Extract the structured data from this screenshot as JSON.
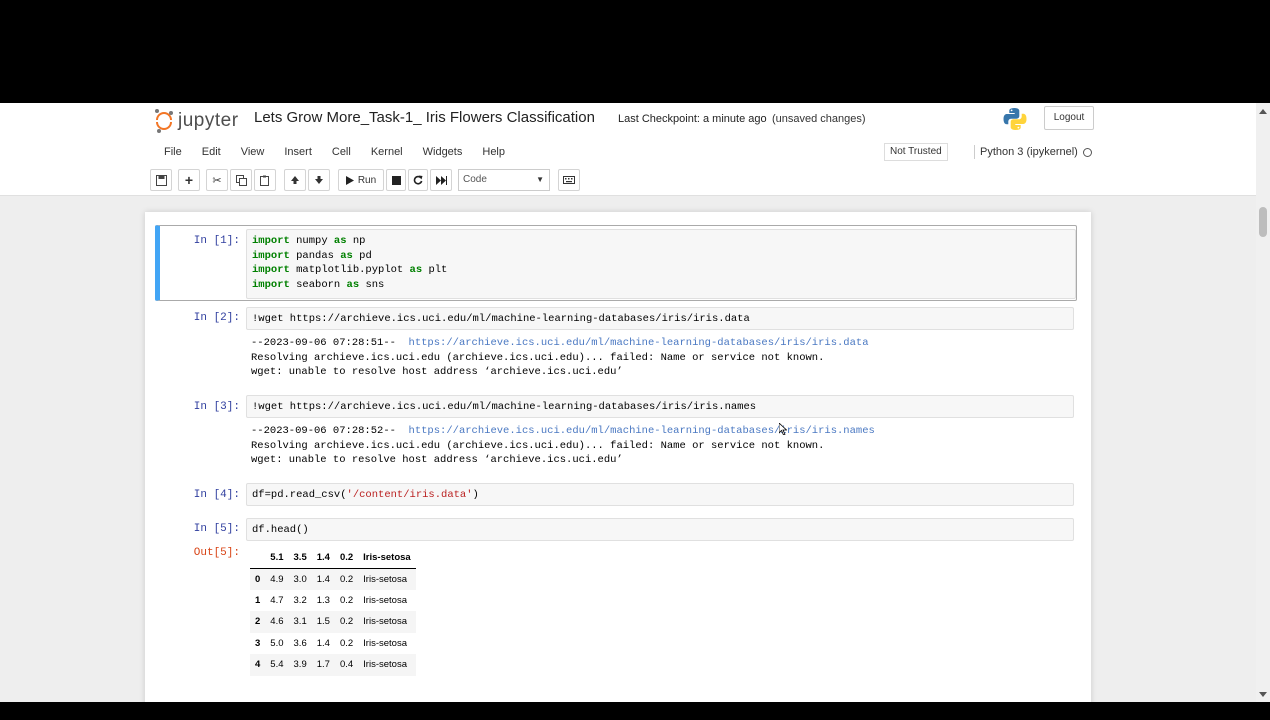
{
  "header": {
    "logo_text": "jupyter",
    "notebook_title": "Lets Grow More_Task-1_ Iris Flowers Classification",
    "checkpoint": "Last Checkpoint: a minute ago",
    "autosave_status": "(unsaved changes)",
    "logout_label": "Logout"
  },
  "menubar": {
    "items": [
      "File",
      "Edit",
      "View",
      "Insert",
      "Cell",
      "Kernel",
      "Widgets",
      "Help"
    ],
    "trust_status": "Not Trusted",
    "kernel_name": "Python 3 (ipykernel)"
  },
  "toolbar": {
    "run_label": "Run",
    "cell_type": "Code"
  },
  "cells": [
    {
      "prompt": "In [1]:",
      "lines": [
        {
          "kw": "import",
          "rest": " numpy ",
          "kw2": "as",
          "rest2": " np"
        },
        {
          "kw": "import",
          "rest": " pandas ",
          "kw2": "as",
          "rest2": " pd"
        },
        {
          "kw": "import",
          "rest": " matplotlib.pyplot ",
          "kw2": "as",
          "rest2": " plt"
        },
        {
          "kw": "import",
          "rest": " seaborn ",
          "kw2": "as",
          "rest2": " sns"
        }
      ]
    },
    {
      "prompt": "In [2]:",
      "code": "!wget https://archieve.ics.uci.edu/ml/machine-learning-databases/iris/iris.data",
      "output": {
        "line1_prefix": "--2023-09-06 07:28:51--  ",
        "line1_url": "https://archieve.ics.uci.edu/ml/machine-learning-databases/iris/iris.data",
        "line2": "Resolving archieve.ics.uci.edu (archieve.ics.uci.edu)... failed: Name or service not known.",
        "line3": "wget: unable to resolve host address ‘archieve.ics.uci.edu’"
      }
    },
    {
      "prompt": "In [3]:",
      "code": "!wget https://archieve.ics.uci.edu/ml/machine-learning-databases/iris/iris.names",
      "output": {
        "line1_prefix": "--2023-09-06 07:28:52--  ",
        "line1_url": "https://archieve.ics.uci.edu/ml/machine-learning-databases/iris/iris.names",
        "line2": "Resolving archieve.ics.uci.edu (archieve.ics.uci.edu)... failed: Name or service not known.",
        "line3": "wget: unable to resolve host address ‘archieve.ics.uci.edu’"
      }
    },
    {
      "prompt": "In [4]:",
      "code_prefix": "df=pd.read_csv(",
      "code_string": "'/content/iris.data'",
      "code_suffix": ")"
    },
    {
      "prompt": "In [5]:",
      "code": "df.head()",
      "out_prompt": "Out[5]:",
      "table": {
        "columns": [
          "",
          "5.1",
          "3.5",
          "1.4",
          "0.2",
          "Iris-setosa"
        ],
        "rows": [
          [
            "0",
            "4.9",
            "3.0",
            "1.4",
            "0.2",
            "Iris-setosa"
          ],
          [
            "1",
            "4.7",
            "3.2",
            "1.3",
            "0.2",
            "Iris-setosa"
          ],
          [
            "2",
            "4.6",
            "3.1",
            "1.5",
            "0.2",
            "Iris-setosa"
          ],
          [
            "3",
            "5.0",
            "3.6",
            "1.4",
            "0.2",
            "Iris-setosa"
          ],
          [
            "4",
            "5.4",
            "3.9",
            "1.7",
            "0.4",
            "Iris-setosa"
          ]
        ]
      }
    }
  ],
  "colors": {
    "accent_orange": "#f37626",
    "selected_border": "#42a5f5",
    "in_prompt": "#303f9f",
    "out_prompt": "#d84315",
    "keyword": "#008000",
    "link": "#4a78c2"
  }
}
